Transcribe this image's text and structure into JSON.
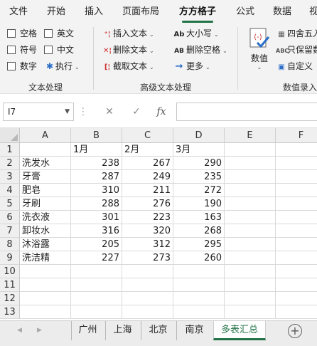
{
  "menu": {
    "tabs": [
      "文件",
      "开始",
      "插入",
      "页面布局",
      "方方格子",
      "公式",
      "数据",
      "视"
    ],
    "active_index": 4
  },
  "ribbon": {
    "group1": {
      "label": "文本处理",
      "items": [
        "空格",
        "英文",
        "符号",
        "中文",
        "数字",
        "执行"
      ]
    },
    "group2": {
      "label": "高级文本处理",
      "insert_text": "插入文本",
      "delete_text": "删除文本",
      "cut_text": "截取文本",
      "case": "大小写",
      "delete_space": "删除空格",
      "more": "更多"
    },
    "group3": {
      "label": "数值录入",
      "value_btn": "数值",
      "round": "四舍五入",
      "keep_only": "只保留数",
      "custom": "自定义"
    }
  },
  "formula_bar": {
    "name_box": "I7",
    "fx": "fx",
    "content": ""
  },
  "sheet": {
    "columns": [
      "A",
      "B",
      "C",
      "D",
      "E",
      "F"
    ],
    "row_numbers": [
      "1",
      "2",
      "3",
      "4",
      "5",
      "6",
      "7",
      "8",
      "9",
      "10",
      "11",
      "12",
      "13"
    ],
    "header_row": [
      "",
      "1月",
      "2月",
      "3月"
    ],
    "rows": [
      {
        "name": "洗发水",
        "m1": "238",
        "m2": "267",
        "m3": "290"
      },
      {
        "name": "牙膏",
        "m1": "287",
        "m2": "249",
        "m3": "235"
      },
      {
        "name": "肥皂",
        "m1": "310",
        "m2": "211",
        "m3": "272"
      },
      {
        "name": "牙刷",
        "m1": "288",
        "m2": "276",
        "m3": "190"
      },
      {
        "name": "洗衣液",
        "m1": "301",
        "m2": "223",
        "m3": "163"
      },
      {
        "name": "卸妆水",
        "m1": "316",
        "m2": "320",
        "m3": "268"
      },
      {
        "name": "沐浴露",
        "m1": "205",
        "m2": "312",
        "m3": "295"
      },
      {
        "name": "洗洁精",
        "m1": "227",
        "m2": "273",
        "m3": "260"
      }
    ]
  },
  "sheet_tabs": {
    "tabs": [
      "广州",
      "上海",
      "北京",
      "南京",
      "多表汇总"
    ],
    "active_index": 4
  },
  "colors": {
    "accent": "#217346"
  }
}
